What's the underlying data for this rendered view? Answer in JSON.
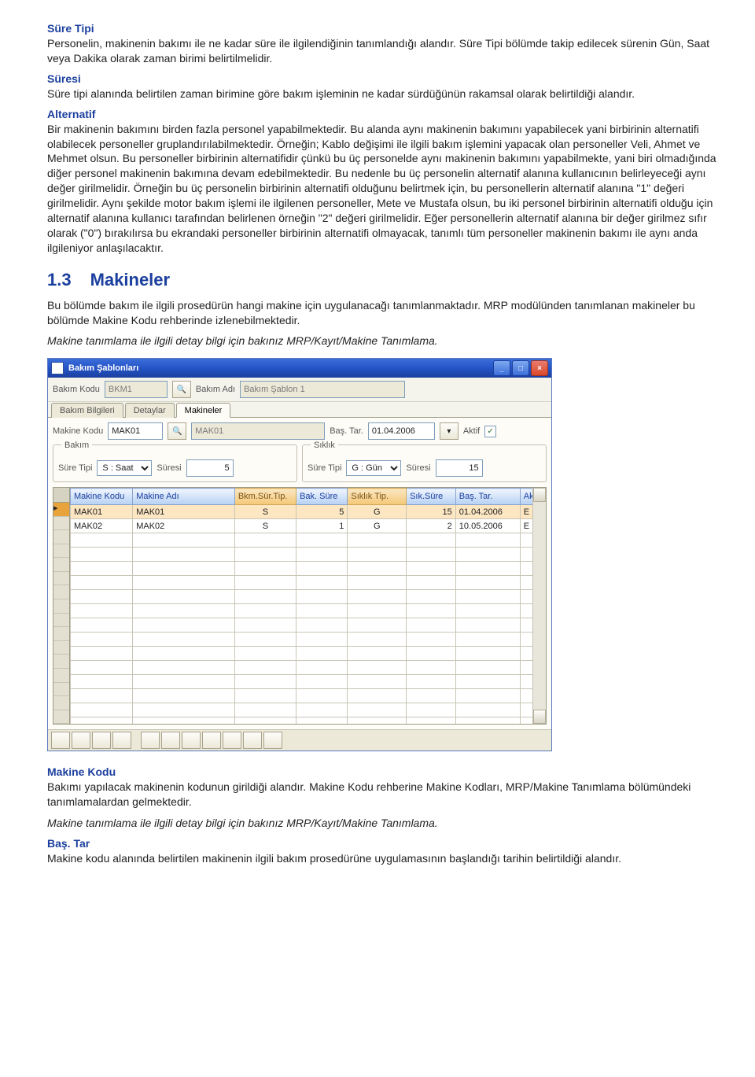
{
  "doc": {
    "h_sure_tipi": "Süre Tipi",
    "p_sure_tipi": "Personelin, makinenin bakımı ile ne kadar süre ile ilgilendiğinin tanımlandığı alandır. Süre Tipi bölümde takip edilecek sürenin Gün, Saat veya Dakika olarak zaman birimi belirtilmelidir.",
    "h_suresi": "Süresi",
    "p_suresi": "Süre tipi alanında belirtilen zaman birimine göre bakım işleminin ne kadar sürdüğünün rakamsal olarak belirtildiği alandır.",
    "h_alternatif": "Alternatif",
    "p_alternatif": "Bir makinenin bakımını birden fazla personel yapabilmektedir. Bu alanda aynı makinenin bakımını yapabilecek yani birbirinin alternatifi olabilecek personeller gruplandırılabilmektedir. Örneğin; Kablo değişimi ile ilgili bakım işlemini yapacak olan personeller Veli, Ahmet ve Mehmet olsun. Bu personeller birbirinin alternatifidir çünkü bu üç personelde aynı makinenin bakımını yapabilmekte, yani biri olmadığında diğer personel makinenin bakımına devam edebilmektedir. Bu nedenle bu üç personelin alternatif alanına kullanıcının belirleyeceği aynı değer girilmelidir. Örneğin bu üç personelin birbirinin alternatifi olduğunu belirtmek için, bu personellerin alternatif alanına \"1\" değeri girilmelidir. Aynı şekilde motor bakım işlemi ile ilgilenen personeller, Mete ve Mustafa olsun, bu iki personel birbirinin alternatifi olduğu için alternatif alanına kullanıcı tarafından belirlenen örneğin \"2\" değeri girilmelidir. Eğer personellerin alternatif alanına bir değer girilmez sıfır olarak (\"0\") bırakılırsa bu ekrandaki personeller birbirinin alternatifi olmayacak, tanımlı tüm personeller makinenin bakımı ile aynı anda ilgileniyor anlaşılacaktır.",
    "section_number": "1.3",
    "section_title": "Makineler",
    "p_makineler_1": "Bu bölümde bakım ile ilgili prosedürün hangi makine için uygulanacağı tanımlanmaktadır. MRP modülünden tanımlanan makineler bu bölümde Makine Kodu rehberinde izlenebilmektedir.",
    "p_makineler_2": "Makine tanımlama ile ilgili detay bilgi için bakınız MRP/Kayıt/Makine Tanımlama.",
    "h_makine_kodu": "Makine Kodu",
    "p_makine_kodu_1": "Bakımı yapılacak makinenin kodunun girildiği alandır. Makine Kodu rehberine Makine Kodları, MRP/Makine Tanımlama bölümündeki tanımlamalardan gelmektedir.",
    "p_makine_kodu_2": "Makine tanımlama ile ilgili detay bilgi için bakınız MRP/Kayıt/Makine Tanımlama.",
    "h_bas_tar": "Baş. Tar",
    "p_bas_tar": "Makine kodu alanında belirtilen makinenin ilgili bakım prosedürüne uygulamasının başlandığı tarihin belirtildiği alandır."
  },
  "window": {
    "title": "Bakım Şablonları",
    "labels": {
      "bakim_kodu": "Bakım Kodu",
      "bakim_adi": "Bakım Adı",
      "makine_kodu": "Makine Kodu",
      "bas_tar": "Baş. Tar.",
      "aktif": "Aktif",
      "bakim_group": "Bakım",
      "siklik_group": "Sıklık",
      "sure_tipi": "Süre Tipi",
      "suresi": "Süresi"
    },
    "values": {
      "bakim_kodu": "BKM1",
      "bakim_adi": "Bakım Şablon 1",
      "makine_kodu": "MAK01",
      "makine_adi": "MAK01",
      "bas_tar": "01.04.2006",
      "aktif_checked": "✓",
      "bakim_sure_tipi": "S : Saat",
      "bakim_suresi": "5",
      "siklik_sure_tipi": "G : Gün",
      "siklik_suresi": "15"
    },
    "tabs": [
      "Bakım Bilgileri",
      "Detaylar",
      "Makineler"
    ],
    "grid_headers": [
      "Makine Kodu",
      "Makine Adı",
      "Bkm.Sür.Tip.",
      "Bak. Süre",
      "Sıklık Tip.",
      "Sık.Süre",
      "Baş. Tar.",
      "Aktif"
    ],
    "grid_rows": [
      {
        "kodu": "MAK01",
        "adi": "MAK01",
        "bst": "S",
        "bs": "5",
        "st": "G",
        "ss": "15",
        "tar": "01.04.2006",
        "aktif": "E"
      },
      {
        "kodu": "MAK02",
        "adi": "MAK02",
        "bst": "S",
        "bs": "1",
        "st": "G",
        "ss": "2",
        "tar": "10.05.2006",
        "aktif": "E"
      }
    ]
  }
}
